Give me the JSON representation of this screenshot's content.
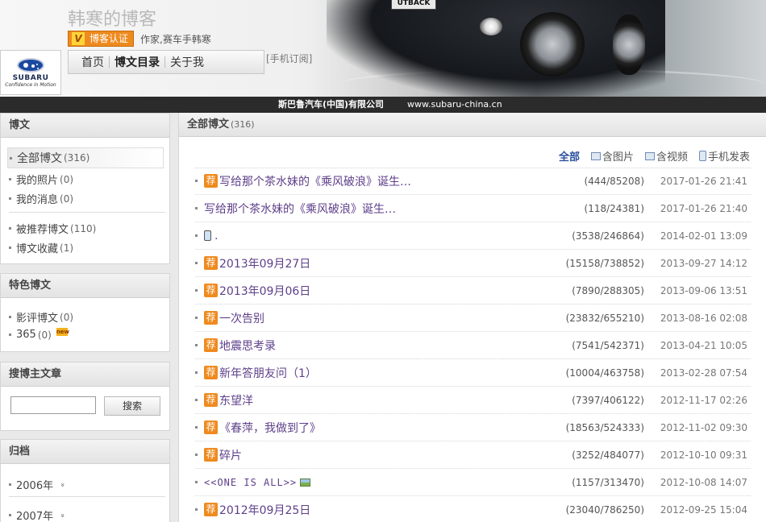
{
  "header": {
    "blog_title": "韩寒的博客",
    "verify_mark": "V",
    "verify_badge": "博客认证",
    "verify_desc": "作家,赛车手韩寒",
    "nav": [
      "首页",
      "博文目录",
      "关于我"
    ],
    "subscribe": "[手机订阅]",
    "car_plate": "UTBACK"
  },
  "sponsor": {
    "logo_text": "SUBARU",
    "logo_tagline": "Confidence in Motion",
    "company": "斯巴鲁汽车(中国)有限公司",
    "url": "www.subaru-china.cn"
  },
  "sidebar": {
    "posts_heading": "博文",
    "posts_items": [
      {
        "label": "全部博文",
        "count": "(316)"
      },
      {
        "label": "我的照片",
        "count": "(0)"
      },
      {
        "label": "我的消息",
        "count": "(0)"
      },
      {
        "label": "被推荐博文",
        "count": "(110)"
      },
      {
        "label": "博文收藏",
        "count": "(1)"
      }
    ],
    "featured_heading": "特色博文",
    "featured_items": [
      {
        "label": "影评博文",
        "count": "(0)"
      },
      {
        "label": "365",
        "count": "(0)",
        "new_tag": "new"
      }
    ],
    "search_heading": "搜博主文章",
    "search_value": "",
    "search_button": "搜索",
    "archive_heading": "归档",
    "archive_items": [
      "2006年",
      "2007年"
    ],
    "archive_expand_glyph": "»"
  },
  "main": {
    "heading": "全部博文",
    "heading_count": "(316)",
    "filters": [
      "全部",
      "含图片",
      "含视频",
      "手机发表"
    ],
    "rec_label": "荐",
    "posts": [
      {
        "title": "写给那个茶水妹的《乘风破浪》诞生…",
        "stats": "(444/85208)",
        "date": "2017-01-26 21:41",
        "rec": true
      },
      {
        "title": "写给那个茶水妹的《乘风破浪》诞生…",
        "stats": "(118/24381)",
        "date": "2017-01-26 21:40",
        "rec": false
      },
      {
        "title": ".",
        "stats": "(3538/246864)",
        "date": "2014-02-01 13:09",
        "rec": false,
        "phone": true
      },
      {
        "title": "2013年09月27日",
        "stats": "(15158/738852)",
        "date": "2013-09-27 14:12",
        "rec": true
      },
      {
        "title": "2013年09月06日",
        "stats": "(7890/288305)",
        "date": "2013-09-06 13:51",
        "rec": true
      },
      {
        "title": "一次告别",
        "stats": "(23832/655210)",
        "date": "2013-08-16 02:08",
        "rec": true
      },
      {
        "title": "地震思考录",
        "stats": "(7541/542371)",
        "date": "2013-04-21 10:05",
        "rec": true
      },
      {
        "title": "新年答朋友问（1）",
        "stats": "(10004/463758)",
        "date": "2013-02-28 07:54",
        "rec": true
      },
      {
        "title": "东望洋",
        "stats": "(7397/406122)",
        "date": "2012-11-17 02:26",
        "rec": true
      },
      {
        "title": "《春萍，我做到了》",
        "stats": "(18563/524333)",
        "date": "2012-11-02 09:30",
        "rec": true
      },
      {
        "title": "碎片",
        "stats": "(3252/484077)",
        "date": "2012-10-10 09:31",
        "rec": true
      },
      {
        "title": "<<ONE  IS  ALL>>",
        "stats": "(1157/313470)",
        "date": "2012-10-08 14:07",
        "rec": false,
        "pic": true
      },
      {
        "title": "2012年09月25日",
        "stats": "(23040/786250)",
        "date": "2012-09-25 15:04",
        "rec": true
      }
    ]
  },
  "colors": {
    "accent_orange": "#ef8a1f",
    "title_purple": "#5e3f8a",
    "filter_active_blue": "#2b4f9e"
  }
}
